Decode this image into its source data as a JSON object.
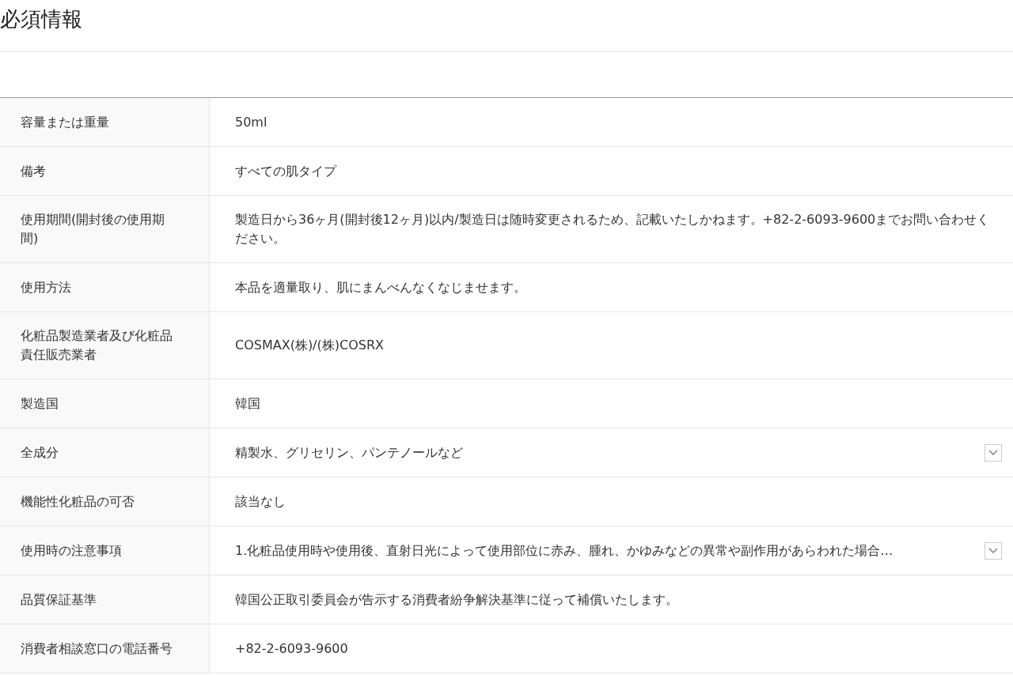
{
  "title": "必須情報",
  "rows": [
    {
      "label": "容量または重量",
      "value": "50ml"
    },
    {
      "label": "備考",
      "value": "すべての肌タイプ"
    },
    {
      "label": "使用期間(開封後の使用期間)",
      "value": "製造日から36ヶ月(開封後12ヶ月)以内/製造日は随時変更されるため、記載いたしかねます。+82-2-6093-9600までお問い合わせください。"
    },
    {
      "label": "使用方法",
      "value": "本品を適量取り、肌にまんべんなくなじませます。"
    },
    {
      "label": "化粧品製造業者及び化粧品責任販売業者",
      "value": "COSMAX(株)/(株)COSRX"
    },
    {
      "label": "製造国",
      "value": "韓国"
    },
    {
      "label": "全成分",
      "value": "精製水、グリセリン、パンテノールなど",
      "expanded": false
    },
    {
      "label": "機能性化粧品の可否",
      "value": "該当なし"
    },
    {
      "label": "使用時の注意事項",
      "value": "1.化粧品使用時や使用後、直射日光によって使用部位に赤み、腫れ、かゆみなどの異常や副作用があらわれた場合…",
      "expanded": false
    },
    {
      "label": "品質保証基準",
      "value": "韓国公正取引委員会が告示する消費者紛争解決基準に従って補償いたします。"
    },
    {
      "label": "消費者相談窓口の電話番号",
      "value": "+82-2-6093-9600"
    }
  ]
}
